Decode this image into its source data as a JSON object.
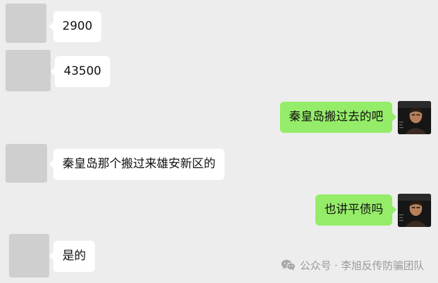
{
  "messages": [
    {
      "side": "left",
      "text": "2900"
    },
    {
      "side": "left",
      "text": "43500"
    },
    {
      "side": "right",
      "text": "秦皇岛搬过去的吧"
    },
    {
      "side": "left",
      "text": "秦皇岛那个搬过来雄安新区的"
    },
    {
      "side": "right",
      "text": "也讲平债吗"
    },
    {
      "side": "left",
      "text": "是的"
    }
  ],
  "watermark": {
    "icon": "wechat-icon",
    "text": "公众号 · 李旭反传防骗团队"
  },
  "colors": {
    "background": "#ededed",
    "left_bubble": "#ffffff",
    "right_bubble": "#95ec69",
    "placeholder_avatar": "#cfcfcf"
  }
}
